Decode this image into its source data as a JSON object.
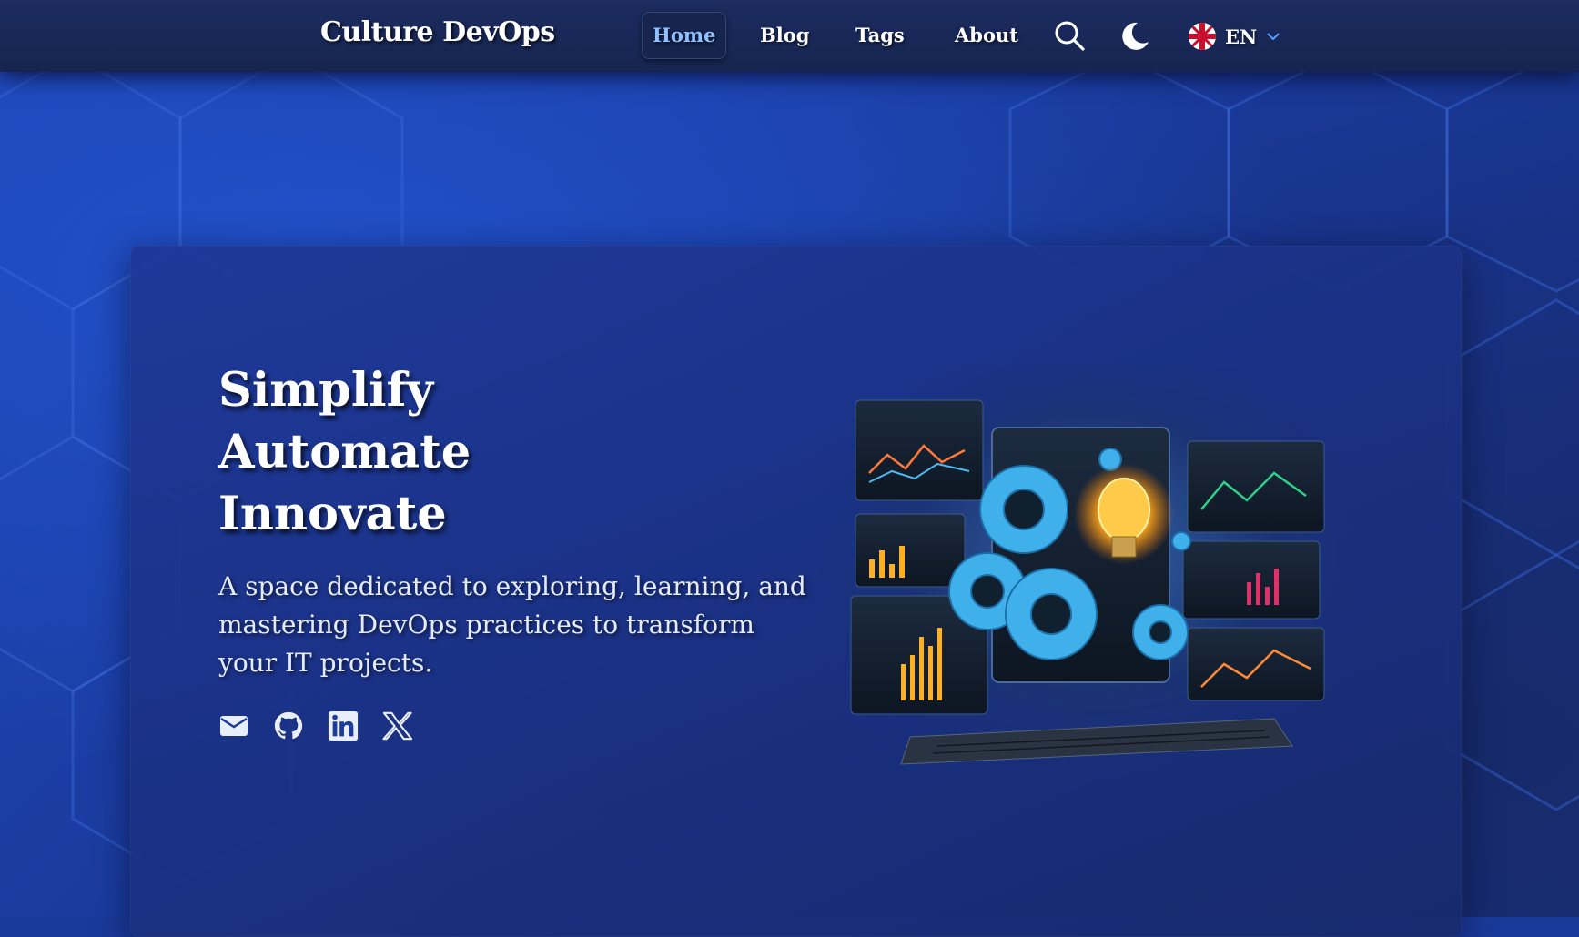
{
  "navbar": {
    "brand": "Culture DevOps",
    "links": [
      {
        "label": "Home",
        "active": true
      },
      {
        "label": "Blog",
        "active": false
      },
      {
        "label": "Tags",
        "active": false
      },
      {
        "label": "About",
        "active": false
      }
    ],
    "icons": [
      "search-icon",
      "moon-icon"
    ],
    "language": {
      "code": "EN",
      "flag": "uk-flag-icon"
    }
  },
  "hero": {
    "tagline": [
      "Simplify",
      "Automate",
      "Innovate"
    ],
    "description": "A space dedicated to exploring, learning, and mastering DevOps practices to transform your IT projects.",
    "social_icons": [
      "mail-icon",
      "github-icon",
      "linkedin-icon",
      "x-icon"
    ],
    "illustration": "devops-dashboard-illustration"
  },
  "colors": {
    "background": "#1a3a9a",
    "navbar": "#16244f",
    "active_link": "#8fc0ff",
    "text": "#ffffff",
    "accent_blue": "#4fb8ee",
    "bulb": "#ffb020"
  }
}
